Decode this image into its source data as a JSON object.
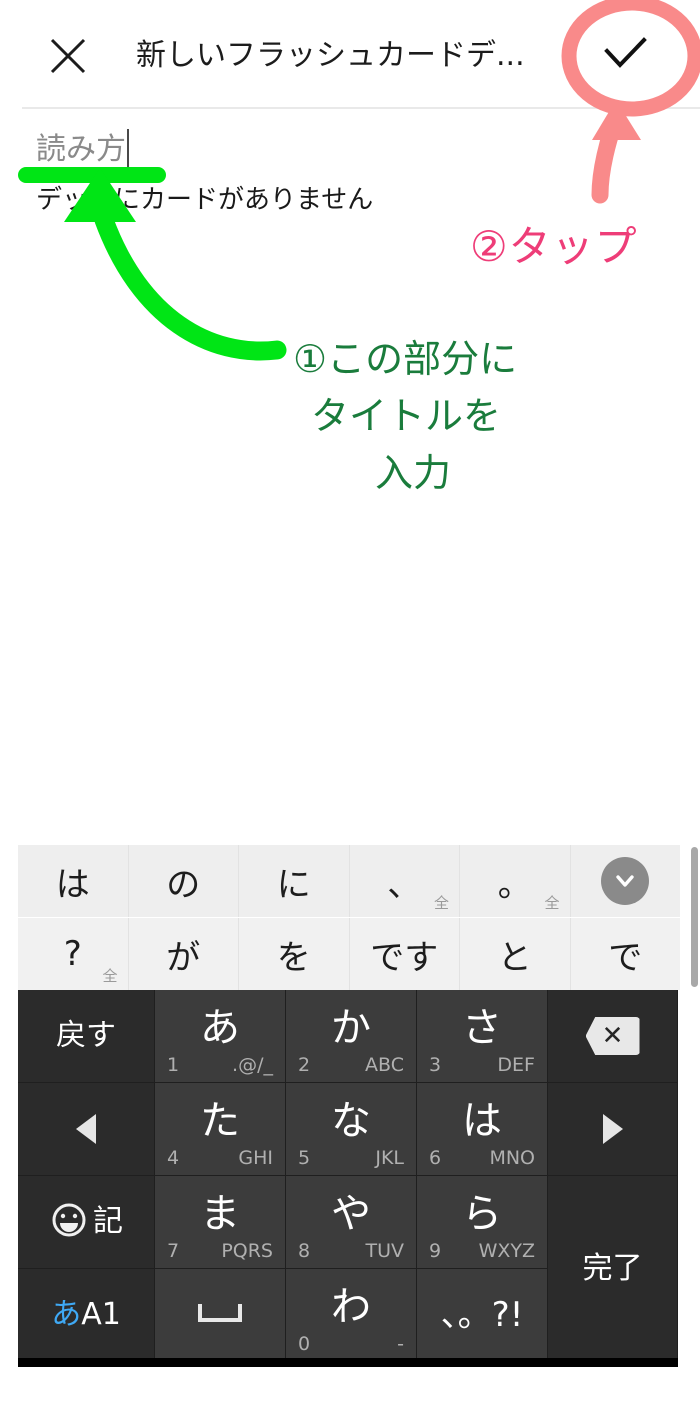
{
  "appbar": {
    "close_icon": "close-icon",
    "title": "新しいフラッシュカードデ...",
    "done_icon": "check-icon"
  },
  "content": {
    "field_value": "読み方",
    "empty_message": "デッキにカードがありません"
  },
  "annotations": {
    "tap_label": "②タップ",
    "input_line1": "①この部分に",
    "input_line2": "タイトルを",
    "input_line3": "入力",
    "green_color": "#00e515",
    "green_text_color": "#1a7c3c",
    "pink_color": "#f98a8a",
    "pink_text_color": "#ee3d78"
  },
  "keyboard": {
    "suggestion_row_1": [
      {
        "word": "は",
        "zen": ""
      },
      {
        "word": "の",
        "zen": ""
      },
      {
        "word": "に",
        "zen": ""
      },
      {
        "word": "、",
        "zen": "全"
      },
      {
        "word": "。",
        "zen": "全"
      }
    ],
    "suggestion_expand_icon": "chevron-down-icon",
    "suggestion_row_2": [
      {
        "word": "?",
        "zen": "全"
      },
      {
        "word": "が",
        "zen": ""
      },
      {
        "word": "を",
        "zen": ""
      },
      {
        "word": "です",
        "zen": ""
      },
      {
        "word": "と",
        "zen": ""
      },
      {
        "word": "で",
        "zen": ""
      }
    ],
    "rows": [
      [
        {
          "name": "undo-key",
          "label": "戻す",
          "num": "",
          "alpha": "",
          "type": "side"
        },
        {
          "name": "key-a",
          "label": "あ",
          "num": "1",
          "alpha": ".@/_",
          "type": "main"
        },
        {
          "name": "key-ka",
          "label": "か",
          "num": "2",
          "alpha": "ABC",
          "type": "main"
        },
        {
          "name": "key-sa",
          "label": "さ",
          "num": "3",
          "alpha": "DEF",
          "type": "main"
        },
        {
          "name": "backspace-key",
          "label": "",
          "num": "",
          "alpha": "",
          "type": "side"
        }
      ],
      [
        {
          "name": "cursor-left-key",
          "label": "",
          "num": "",
          "alpha": "",
          "type": "side"
        },
        {
          "name": "key-ta",
          "label": "た",
          "num": "4",
          "alpha": "GHI",
          "type": "main"
        },
        {
          "name": "key-na",
          "label": "な",
          "num": "5",
          "alpha": "JKL",
          "type": "main"
        },
        {
          "name": "key-ha",
          "label": "は",
          "num": "6",
          "alpha": "MNO",
          "type": "main"
        },
        {
          "name": "cursor-right-key",
          "label": "",
          "num": "",
          "alpha": "",
          "type": "side"
        }
      ],
      [
        {
          "name": "emoji-symbol-key",
          "label": "記",
          "num": "",
          "alpha": "",
          "type": "side"
        },
        {
          "name": "key-ma",
          "label": "ま",
          "num": "7",
          "alpha": "PQRS",
          "type": "main"
        },
        {
          "name": "key-ya",
          "label": "や",
          "num": "8",
          "alpha": "TUV",
          "type": "main"
        },
        {
          "name": "key-ra",
          "label": "ら",
          "num": "9",
          "alpha": "WXYZ",
          "type": "main"
        },
        {
          "name": "enter-key",
          "label": "完了",
          "num": "",
          "alpha": "",
          "type": "side"
        }
      ],
      [
        {
          "name": "ime-switch-key",
          "label": "あA1",
          "num": "",
          "alpha": "",
          "type": "side"
        },
        {
          "name": "space-key",
          "label": "␣",
          "num": "",
          "alpha": "",
          "type": "main"
        },
        {
          "name": "key-wa",
          "label": "わ",
          "num": "0",
          "alpha": "-",
          "type": "main"
        },
        {
          "name": "punctuation-key",
          "label": "、。?!",
          "num": "",
          "alpha": "",
          "type": "main"
        }
      ]
    ]
  }
}
